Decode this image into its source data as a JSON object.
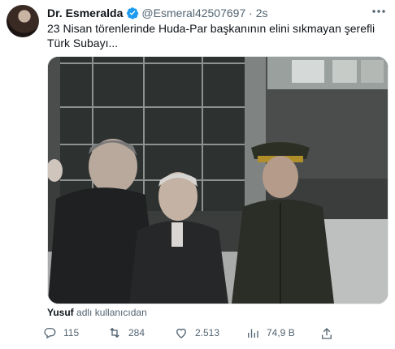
{
  "author": {
    "name": "Dr. Esmeralda",
    "handle": "@Esmeral42507697",
    "time": "2s",
    "verified_color": "#1d9bf0"
  },
  "tweet": {
    "text": "23 Nisan törenlerinde  Huda-Par başkanının elini sıkmayan şerefli  Türk Subayı..."
  },
  "attribution": {
    "user": "Yusuf",
    "suffix": "adlı kullanıcıdan"
  },
  "actions": {
    "replies": "115",
    "retweets": "284",
    "likes": "2.513",
    "views": "74,9 B"
  },
  "icons": [
    "verified-badge-icon",
    "more-icon",
    "reply-icon",
    "retweet-icon",
    "like-icon",
    "views-icon",
    "share-icon"
  ]
}
